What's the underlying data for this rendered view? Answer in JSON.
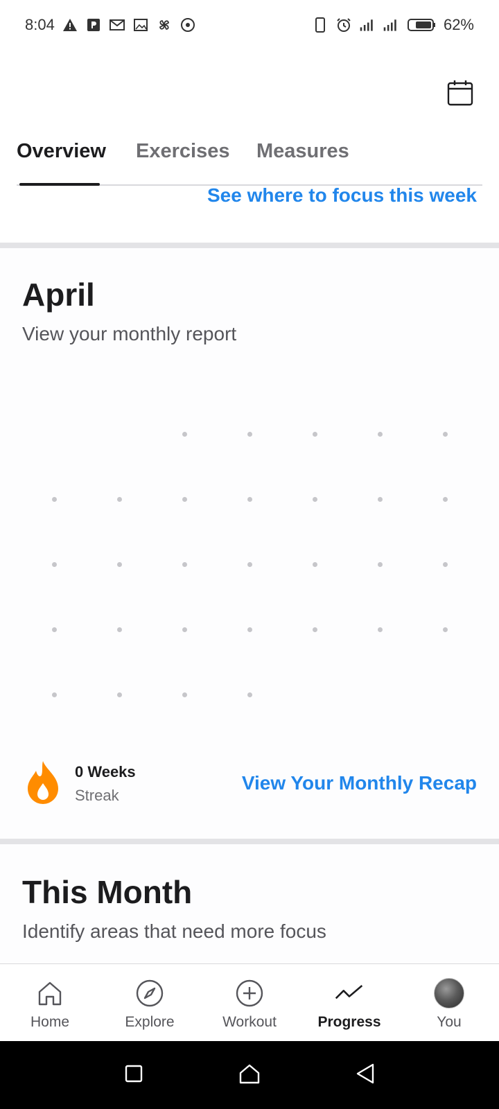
{
  "status_bar": {
    "time": "8:04",
    "battery": "62%",
    "left_icons": [
      "warning-icon",
      "parking-icon",
      "gmail-icon",
      "image-icon",
      "pinwheel-icon",
      "target-icon"
    ],
    "right_icons": [
      "phone-icon",
      "alarm-icon",
      "signal-icon",
      "signal-icon",
      "battery-icon"
    ]
  },
  "header": {
    "calendar_icon": "calendar-icon",
    "tabs": [
      {
        "label": "Overview",
        "active": true
      },
      {
        "label": "Exercises",
        "active": false
      },
      {
        "label": "Measures",
        "active": false
      }
    ],
    "focus_link": "See where to focus this week"
  },
  "monthly": {
    "title": "April",
    "subtitle": "View your monthly report",
    "streak_value": "0 Weeks",
    "streak_label": "Streak",
    "streak_icon": "flame-icon",
    "recap_link": "View Your Monthly Recap"
  },
  "this_month": {
    "title": "This Month",
    "subtitle": "Identify areas that need more focus"
  },
  "bottom_nav": [
    {
      "label": "Home",
      "icon": "home-icon",
      "active": false
    },
    {
      "label": "Explore",
      "icon": "compass-icon",
      "active": false
    },
    {
      "label": "Workout",
      "icon": "plus-circle-icon",
      "active": false
    },
    {
      "label": "Progress",
      "icon": "trend-icon",
      "active": true
    },
    {
      "label": "You",
      "icon": "avatar",
      "active": false
    }
  ],
  "colors": {
    "accent": "#2186eb",
    "flame": "#ff8c00",
    "text_primary": "#1c1c1e",
    "text_secondary": "#55555a"
  }
}
